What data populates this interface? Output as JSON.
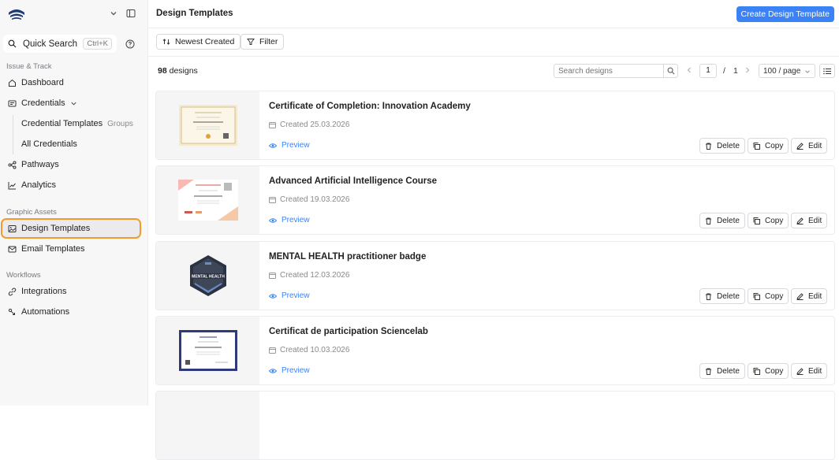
{
  "sidebar": {
    "quick_search": {
      "label": "Quick Search",
      "shortcut": "Ctrl+K"
    },
    "sections": {
      "issue_track": "Issue & Track",
      "graphic_assets": "Graphic Assets",
      "workflows": "Workflows"
    },
    "items": {
      "dashboard": "Dashboard",
      "credentials": "Credentials",
      "credential_templates": "Credential Templates",
      "groups_badge": "Groups",
      "all_credentials": "All Credentials",
      "pathways": "Pathways",
      "analytics": "Analytics",
      "design_templates": "Design Templates",
      "email_templates": "Email Templates",
      "integrations": "Integrations",
      "automations": "Automations"
    }
  },
  "header": {
    "title": "Design Templates",
    "create_label": "Create Design Template"
  },
  "toolbar": {
    "sort_label": "Newest Created",
    "filter_label": "Filter"
  },
  "listing": {
    "count_number": "98",
    "count_suffix": " designs",
    "search_placeholder": "Search designs",
    "page_current": "1",
    "page_sep": "/",
    "page_total": "1",
    "per_page": "100 / page"
  },
  "cards": [
    {
      "title": "Certificate of Completion: Innovation Academy",
      "created": "Created 25.03.2026",
      "preview": "Preview",
      "delete": "Delete",
      "copy": "Copy",
      "edit": "Edit"
    },
    {
      "title": "Advanced Artificial Intelligence Course",
      "created": "Created 19.03.2026",
      "preview": "Preview",
      "delete": "Delete",
      "copy": "Copy",
      "edit": "Edit"
    },
    {
      "title": "MENTAL HEALTH practitioner badge",
      "created": "Created 12.03.2026",
      "preview": "Preview",
      "delete": "Delete",
      "copy": "Copy",
      "edit": "Edit",
      "badge_text": "MENTAL HEALTH"
    },
    {
      "title": "Certificat de participation Sciencelab",
      "created": "Created 10.03.2026",
      "preview": "Preview",
      "delete": "Delete",
      "copy": "Copy",
      "edit": "Edit"
    }
  ],
  "colors": {
    "accent": "#3b82f6",
    "highlight": "#f39a2e"
  }
}
